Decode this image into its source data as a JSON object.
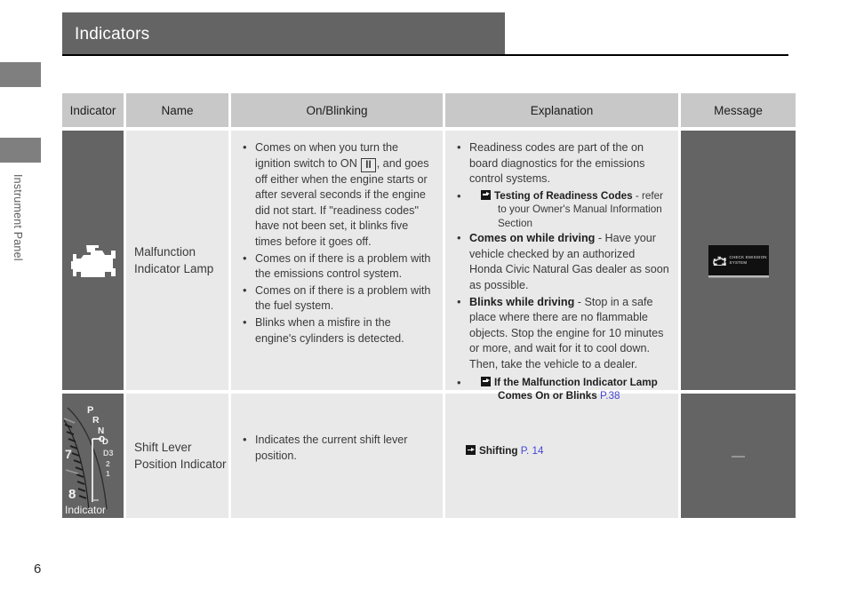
{
  "sidebar": {
    "label": "Instrument Panel",
    "tabs": [
      "tab-upper",
      "tab-active"
    ]
  },
  "header": {
    "title": "Indicators"
  },
  "page": {
    "number": "6"
  },
  "table": {
    "columns": [
      {
        "key": "indicator",
        "label": "Indicator"
      },
      {
        "key": "name",
        "label": "Name"
      },
      {
        "key": "onblinking",
        "label": "On/Blinking"
      },
      {
        "key": "explanation",
        "label": "Explanation"
      },
      {
        "key": "message",
        "label": "Message"
      }
    ],
    "rows": [
      {
        "indicator_icon": "malfunction-indicator-lamp-icon",
        "name": "Malfunction Indicator Lamp",
        "onblinking": {
          "bullets": [
            {
              "pre": "Comes on when you turn the ignition switch to ON ",
              "boxed": "II",
              "post": ", and goes off either when the engine starts or after several seconds if the engine did not start. If \"readiness codes\" have not been set, it blinks five times before it goes off."
            },
            {
              "text": "Comes on if there is a problem with the emissions control system."
            },
            {
              "text": "Comes on if there is a problem with the fuel system."
            },
            {
              "text": "Blinks when a misfire in the engine's cylinders is detected."
            }
          ]
        },
        "explanation": {
          "items": [
            {
              "type": "bullet",
              "text": "Readiness codes are part of the on board diagnostics for the emissions control systems."
            },
            {
              "type": "reference",
              "bold": "Testing of Readiness Codes",
              "rest": " - refer to your Owner's Manual Information Section",
              "pageref": ""
            },
            {
              "type": "bullet",
              "bold": "Comes on while driving",
              "rest": " - Have your vehicle checked by an authorized Honda Civic Natural Gas dealer as soon as possible."
            },
            {
              "type": "bullet",
              "bold": "Blinks while driving",
              "rest": " - Stop in a safe place where there are no flammable objects. Stop the engine for 10 minutes or more, and wait for it to cool down. Then, take the vehicle to a dealer."
            },
            {
              "type": "reference",
              "bold": "If the Malfunction Indicator Lamp Comes On or Blinks",
              "rest": "",
              "pageref": "P.38"
            }
          ]
        },
        "message": {
          "type": "display",
          "line1": "CHECK EMISSION",
          "line2": "SYSTEM",
          "icon": "engine-icon"
        }
      },
      {
        "indicator_icon": "shift-lever-position-gauge",
        "name": "Shift Lever Position Indicator",
        "onblinking": {
          "bullets": [
            {
              "text": "Indicates the current shift lever position."
            }
          ]
        },
        "explanation": {
          "items": [
            {
              "type": "reference",
              "bold": "Shifting",
              "rest": "",
              "pageref": "P. 14"
            }
          ]
        },
        "message": {
          "type": "dash",
          "text": "—"
        }
      }
    ]
  },
  "gauge": {
    "shift_positions": [
      "P",
      "R",
      "N",
      "D",
      "D3",
      "2",
      "1"
    ],
    "tach_numbers": [
      "7",
      "8"
    ],
    "caption": "Indicator"
  },
  "colors": {
    "header_bar": "#646464",
    "table_header": "#c8c8c8",
    "cell_bg": "#e9e9e9",
    "dark_cell": "#646464",
    "pageref": "#4646d2",
    "sidebar_tab": "#7f7f7f"
  }
}
